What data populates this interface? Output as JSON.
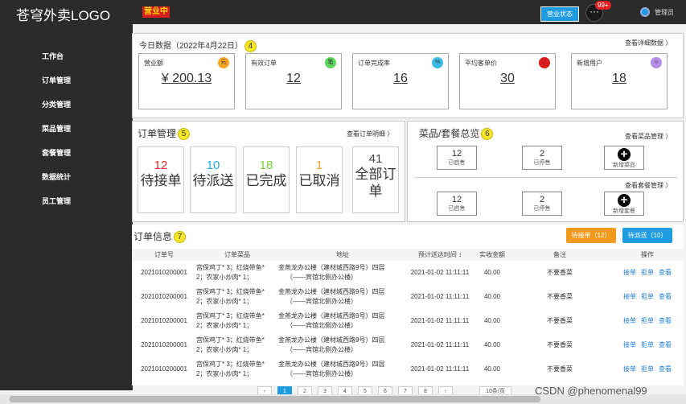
{
  "header": {
    "logo": "苍穹外卖LOGO",
    "status": "营业中",
    "status_button": "营业状态",
    "message_count": "99+",
    "username": "管理员"
  },
  "sidebar": {
    "items": [
      {
        "label": "工作台"
      },
      {
        "label": "订单管理"
      },
      {
        "label": "分类管理"
      },
      {
        "label": "菜品管理"
      },
      {
        "label": "套餐管理"
      },
      {
        "label": "数据统计"
      },
      {
        "label": "员工管理"
      }
    ]
  },
  "today": {
    "title": "今日数据（2022年4月22日）",
    "badge": "4",
    "link": "查看详细数据 〉",
    "stats": [
      {
        "label": "营业额",
        "icon": "元",
        "value": "¥ 200.13",
        "icon_color": "#f5a623"
      },
      {
        "label": "有效订单",
        "icon": "笔",
        "value": "12",
        "icon_color": "#5cd65c"
      },
      {
        "label": "订单完成率",
        "icon": "%",
        "value": "16",
        "icon_color": "#3bbbe8"
      },
      {
        "label": "平均客单价",
        "icon": "",
        "value": "30",
        "icon_color": "#d81e1e"
      },
      {
        "label": "新增用户",
        "icon": "☺",
        "value": "18",
        "icon_color": "#b38be8"
      }
    ]
  },
  "order_mgmt": {
    "title": "订单管理",
    "badge": "5",
    "link": "查看订单明细 〉",
    "items": [
      {
        "count": "12",
        "label": "待接单",
        "color": "#e0272b"
      },
      {
        "count": "10",
        "label": "待派送",
        "color": "#2aa7e6"
      },
      {
        "count": "18",
        "label": "已完成",
        "color": "#7ad33a"
      },
      {
        "count": "1",
        "label": "已取消",
        "color": "#f5a623"
      },
      {
        "count": "41",
        "label": "全部订单",
        "color": "#444444"
      }
    ]
  },
  "overview": {
    "title": "菜品/套餐总览",
    "badge": "6",
    "dish_link": "查看菜品管理 〉",
    "setmeal_link": "查看套餐管理 〉",
    "dish": {
      "on": {
        "count": "12",
        "label": "已启售"
      },
      "off": {
        "count": "2",
        "label": "已停售"
      },
      "add": "新增菜品"
    },
    "setmeal": {
      "on": {
        "count": "12",
        "label": "已启售"
      },
      "off": {
        "count": "2",
        "label": "已停售"
      },
      "add": "新增套餐"
    }
  },
  "order_info": {
    "title": "订单信息",
    "badge": "7",
    "pending_btn": "待接单（12）",
    "delivery_btn": "待派送（10）",
    "columns": [
      "订单号",
      "订单菜品",
      "地址",
      "预计送达时间 ↕",
      "实收金额",
      "备注",
      "操作"
    ],
    "rows": [
      {
        "id": "2021010200001",
        "dish1": "宫保鸡丁* 3；红烧带鱼*",
        "dish2": "2；农家小炒肉* 1；",
        "addr1": "金燕龙办公楼（建材城西路9号）四层",
        "addr2": "（——宾馆北侧办公楼）",
        "time": "2021-01-02 11:11:11",
        "amount": "40.00",
        "note": "不要香菜"
      },
      {
        "id": "2021010200001",
        "dish1": "宫保鸡丁* 3；红烧带鱼*",
        "dish2": "2；农家小炒肉* 1；",
        "addr1": "金燕龙办公楼（建材城西路9号）四层",
        "addr2": "（——宾馆北侧办公楼）",
        "time": "2021-01-02 11:11:11",
        "amount": "40.00",
        "note": "不要香菜"
      },
      {
        "id": "2021010200001",
        "dish1": "宫保鸡丁* 3；红烧带鱼*",
        "dish2": "2；农家小炒肉* 1；",
        "addr1": "金燕龙办公楼（建材城西路9号）四层",
        "addr2": "（——宾馆北侧办公楼）",
        "time": "2021-01-02 11:11:11",
        "amount": "40.00",
        "note": "不要香菜"
      },
      {
        "id": "2021010200001",
        "dish1": "宫保鸡丁* 3；红烧带鱼*",
        "dish2": "2；农家小炒肉* 1；",
        "addr1": "金燕龙办公楼（建材城西路9号）四层",
        "addr2": "（——宾馆北侧办公楼）",
        "time": "2021-01-02 11:11:11",
        "amount": "40.00",
        "note": "不要香菜"
      },
      {
        "id": "2021010200001",
        "dish1": "宫保鸡丁* 3；红烧带鱼*",
        "dish2": "2；农家小炒肉* 1；",
        "addr1": "金燕龙办公楼（建材城西路9号）四层",
        "addr2": "（——宾馆北侧办公楼）",
        "time": "2021-01-02 11:11:11",
        "amount": "40.00",
        "note": "不要香菜"
      }
    ],
    "actions": [
      "接单",
      "拒单",
      "查看"
    ]
  },
  "pagination": {
    "pages": [
      "‹",
      "1",
      "2",
      "3",
      "4",
      "5",
      "6",
      "7",
      "8",
      "›"
    ],
    "page_size": "10条/页"
  },
  "watermark": "CSDN @phenomenal99"
}
